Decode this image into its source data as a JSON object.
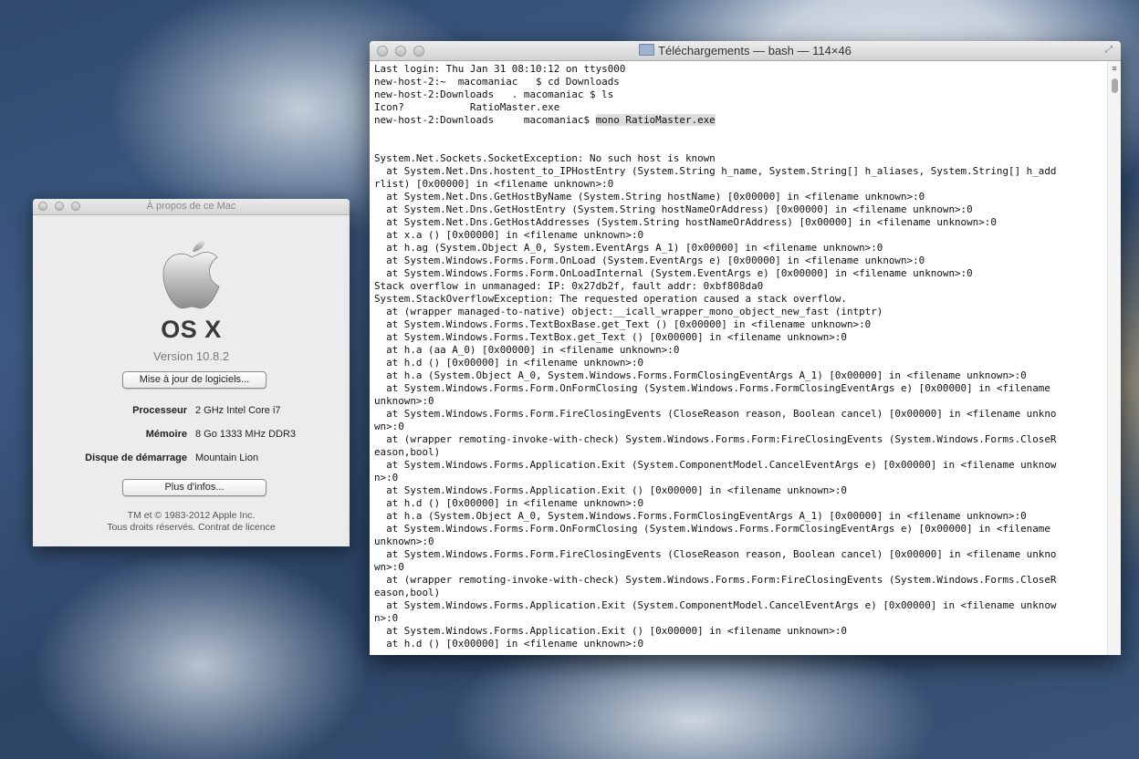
{
  "about_window": {
    "title": "À propos de ce Mac",
    "os_name": "OS X",
    "version": "Version 10.8.2",
    "update_button": "Mise à jour de logiciels...",
    "specs": [
      {
        "label": "Processeur",
        "value": "2 GHz Intel Core i7"
      },
      {
        "label": "Mémoire",
        "value": "8 Go 1333 MHz  DDR3"
      },
      {
        "label": "Disque de démarrage",
        "value": "Mountain Lion"
      }
    ],
    "more_info_button": "Plus d'infos...",
    "copyright": "TM et © 1983-2012 Apple Inc.",
    "rights": "Tous droits réservés.  Contrat de licence"
  },
  "terminal_window": {
    "title": "Téléchargements — bash — 114×46",
    "prompt_lines": [
      "Last login: Thu Jan 31 08:10:12 on ttys000",
      "new-host-2:~  macomaniac   $ cd Downloads",
      "new-host-2:Downloads   . macomaniac $ ls",
      "Icon?           RatioMaster.exe"
    ],
    "last_prompt": "new-host-2:Downloads     macomaniac$ ",
    "last_command": "mono RatioMaster.exe",
    "output_lines": [
      "",
      "",
      "System.Net.Sockets.SocketException: No such host is known",
      "  at System.Net.Dns.hostent_to_IPHostEntry (System.String h_name, System.String[] h_aliases, System.String[] h_add",
      "rlist) [0x00000] in <filename unknown>:0",
      "  at System.Net.Dns.GetHostByName (System.String hostName) [0x00000] in <filename unknown>:0",
      "  at System.Net.Dns.GetHostEntry (System.String hostNameOrAddress) [0x00000] in <filename unknown>:0",
      "  at System.Net.Dns.GetHostAddresses (System.String hostNameOrAddress) [0x00000] in <filename unknown>:0",
      "  at x.a () [0x00000] in <filename unknown>:0",
      "  at h.ag (System.Object A_0, System.EventArgs A_1) [0x00000] in <filename unknown>:0",
      "  at System.Windows.Forms.Form.OnLoad (System.EventArgs e) [0x00000] in <filename unknown>:0",
      "  at System.Windows.Forms.Form.OnLoadInternal (System.EventArgs e) [0x00000] in <filename unknown>:0",
      "Stack overflow in unmanaged: IP: 0x27db2f, fault addr: 0xbf808da0",
      "System.StackOverflowException: The requested operation caused a stack overflow.",
      "  at (wrapper managed-to-native) object:__icall_wrapper_mono_object_new_fast (intptr)",
      "  at System.Windows.Forms.TextBoxBase.get_Text () [0x00000] in <filename unknown>:0",
      "  at System.Windows.Forms.TextBox.get_Text () [0x00000] in <filename unknown>:0",
      "  at h.a (aa A_0) [0x00000] in <filename unknown>:0",
      "  at h.d () [0x00000] in <filename unknown>:0",
      "  at h.a (System.Object A_0, System.Windows.Forms.FormClosingEventArgs A_1) [0x00000] in <filename unknown>:0",
      "  at System.Windows.Forms.Form.OnFormClosing (System.Windows.Forms.FormClosingEventArgs e) [0x00000] in <filename",
      "unknown>:0",
      "  at System.Windows.Forms.Form.FireClosingEvents (CloseReason reason, Boolean cancel) [0x00000] in <filename unkno",
      "wn>:0",
      "  at (wrapper remoting-invoke-with-check) System.Windows.Forms.Form:FireClosingEvents (System.Windows.Forms.CloseR",
      "eason,bool)",
      "  at System.Windows.Forms.Application.Exit (System.ComponentModel.CancelEventArgs e) [0x00000] in <filename unknow",
      "n>:0",
      "  at System.Windows.Forms.Application.Exit () [0x00000] in <filename unknown>:0",
      "  at h.d () [0x00000] in <filename unknown>:0",
      "  at h.a (System.Object A_0, System.Windows.Forms.FormClosingEventArgs A_1) [0x00000] in <filename unknown>:0",
      "  at System.Windows.Forms.Form.OnFormClosing (System.Windows.Forms.FormClosingEventArgs e) [0x00000] in <filename",
      "unknown>:0",
      "  at System.Windows.Forms.Form.FireClosingEvents (CloseReason reason, Boolean cancel) [0x00000] in <filename unkno",
      "wn>:0",
      "  at (wrapper remoting-invoke-with-check) System.Windows.Forms.Form:FireClosingEvents (System.Windows.Forms.CloseR",
      "eason,bool)",
      "  at System.Windows.Forms.Application.Exit (System.ComponentModel.CancelEventArgs e) [0x00000] in <filename unknow",
      "n>:0",
      "  at System.Windows.Forms.Application.Exit () [0x00000] in <filename unknown>:0",
      "  at h.d () [0x00000] in <filename unknown>:0"
    ]
  }
}
